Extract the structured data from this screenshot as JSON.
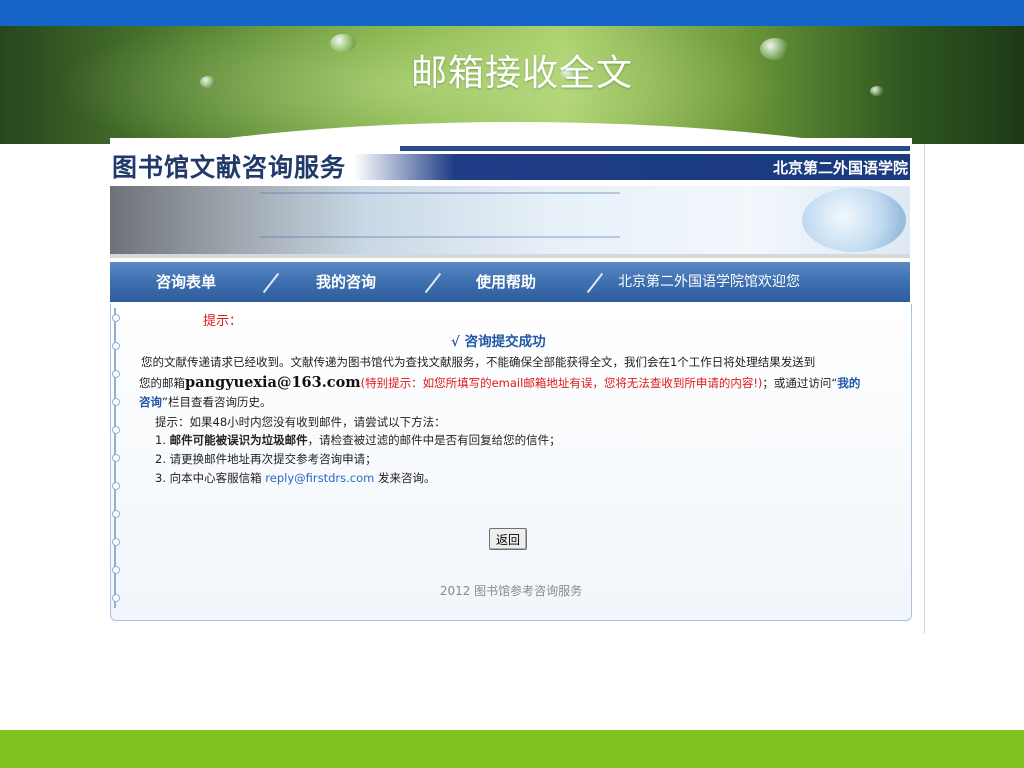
{
  "slide": {
    "title": "邮箱接收全文"
  },
  "header": {
    "logo": "图书馆文献咨询服务",
    "school": "北京第二外国语学院"
  },
  "nav": {
    "items": [
      {
        "label": "咨询表单"
      },
      {
        "label": "我的咨询"
      },
      {
        "label": "使用帮助"
      }
    ],
    "welcome": "北京第二外国语学院馆欢迎您"
  },
  "notice": {
    "label": "提示：",
    "success": "√ 咨询提交成功",
    "line1": "您的文献传递请求已经收到。文献传递为图书馆代为查找文献服务，不能确保全部能获得全文，我们会在1个工作日将处理结果发送到",
    "mailbox_prefix": "您的邮箱",
    "email": "pangyuexia@163.com",
    "warning": "(特别提示：如您所填写的email邮箱地址有误，您将无法查收到所申请的内容!)",
    "via_text": "；或通过访问“",
    "my_query_a": "我的",
    "my_query_b": "咨询",
    "history_text": "”栏目查看咨询历史。"
  },
  "tips": {
    "intro": "提示：如果48小时内您没有收到邮件，请尝试以下方法：",
    "item1_prefix": "1. ",
    "item1_bold": "邮件可能被误识为垃圾邮件",
    "item1_rest": "，请检查被过滤的邮件中是否有回复给您的信件；",
    "item2": "2. 请更换邮件地址再次提交参考咨询申请；",
    "item3_prefix": "3. 向本中心客服信箱",
    "item3_email": "reply@firstdrs.com",
    "item3_suffix": "发来咨询。"
  },
  "actions": {
    "return_label": "返回"
  },
  "footer": {
    "text": "2012 图书馆参考咨询服务"
  },
  "colors": {
    "top_bar": "#1565c8",
    "bottom_bar": "#80c21f",
    "nav": "#3d6fb0",
    "accent_red": "#e01818",
    "accent_blue": "#1f56a8"
  }
}
